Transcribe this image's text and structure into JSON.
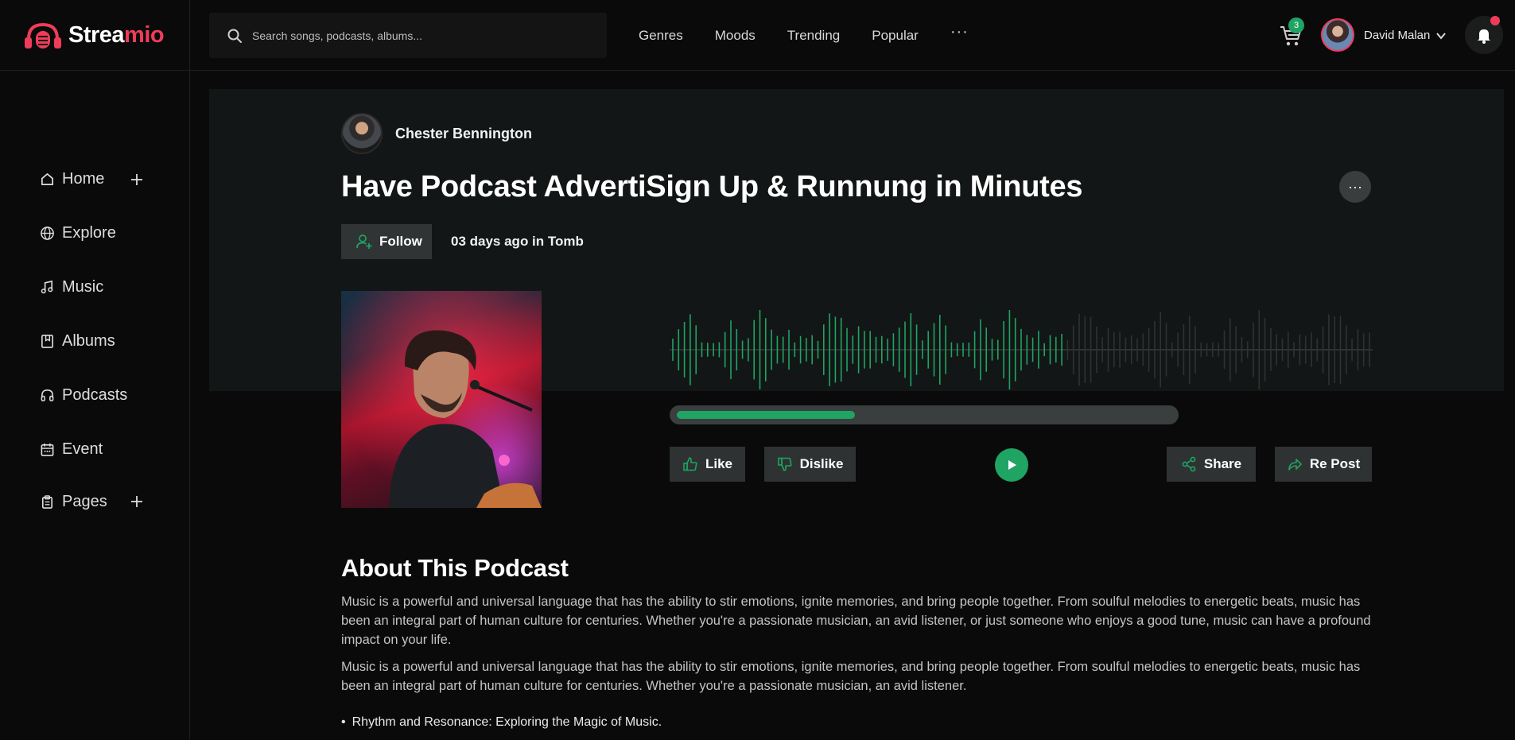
{
  "brand": {
    "name_part1": "Strea",
    "name_part2": "mio"
  },
  "search": {
    "placeholder": "Search songs, podcasts, albums..."
  },
  "topnav": {
    "items": [
      "Genres",
      "Moods",
      "Trending",
      "Popular"
    ],
    "more": "···"
  },
  "cart": {
    "count": "3"
  },
  "user": {
    "name": "David Malan"
  },
  "sidebar": {
    "items": [
      {
        "label": "Home",
        "icon": "home-icon"
      },
      {
        "label": "Explore",
        "icon": "globe-icon"
      },
      {
        "label": "Music",
        "icon": "music-note-icon"
      },
      {
        "label": "Albums",
        "icon": "album-icon"
      },
      {
        "label": "Podcasts",
        "icon": "headphones-icon"
      },
      {
        "label": "Event",
        "icon": "calendar-icon"
      },
      {
        "label": "Pages",
        "icon": "clipboard-icon"
      }
    ]
  },
  "podcast": {
    "author": "Chester Bennington",
    "title": "Have Podcast AdvertiSign Up & Runnung in Minutes",
    "follow_label": "Follow",
    "posted_meta": "03 days ago in Tomb",
    "progress_fraction": 0.36,
    "like_label": "Like",
    "dislike_label": "Dislike",
    "share_label": "Share",
    "repost_label": "Re Post"
  },
  "about": {
    "heading": "About This Podcast",
    "paragraph1": "Music is a powerful and universal language that has the ability to stir emotions, ignite memories, and bring people together. From soulful melodies to energetic beats, music has been an integral part of human culture for centuries. Whether you're a passionate musician, an avid listener, or just someone who enjoys a good tune, music can have a profound impact on your life.",
    "paragraph2": "Music is a powerful and universal language that has the ability to stir emotions, ignite memories, and bring people together. From soulful melodies to energetic beats, music has been an integral part of human culture for centuries. Whether you're a passionate musician, an avid listener.",
    "bullet1": "Rhythm and Resonance: Exploring the Magic of Music."
  },
  "colors": {
    "accent": "#1fa463",
    "brand": "#ef3c5a",
    "background": "#0a0a0a",
    "hero_band": "#131616"
  }
}
